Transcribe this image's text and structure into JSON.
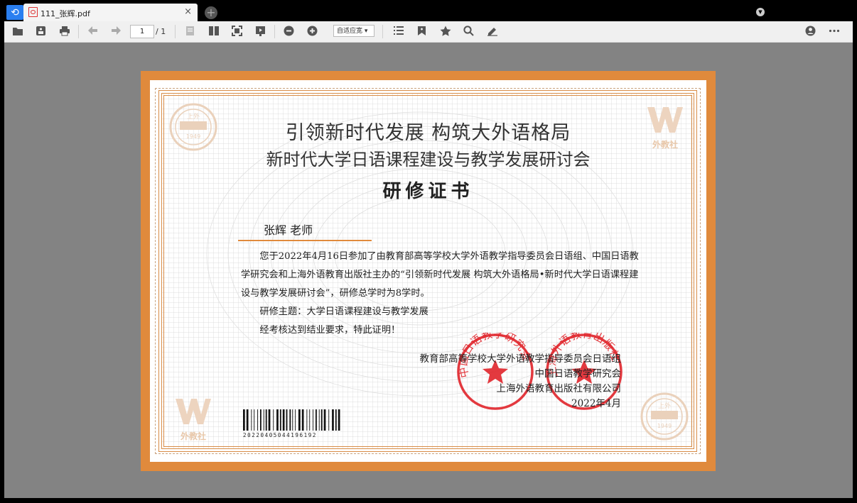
{
  "tab": {
    "title": "111_张辉.pdf",
    "close": "×",
    "new_tab": "+"
  },
  "toolbar": {
    "page_current": "1",
    "page_total": "/ 1",
    "zoom": "自适应宽 ▾"
  },
  "icons": [
    "open-folder-icon",
    "save-icon",
    "print-icon",
    "prev-page-icon",
    "next-page-icon",
    "single-page-icon",
    "two-page-icon",
    "fit-page-icon",
    "present-icon",
    "zoom-out-icon",
    "zoom-in-icon",
    "list-icon",
    "bookmark-icon",
    "star-icon",
    "search-icon",
    "pen-icon",
    "account-icon",
    "more-icon"
  ],
  "certificate": {
    "title1": "引领新时代发展 构筑大外语格局",
    "title2": "新时代大学日语课程建设与教学发展研讨会",
    "title3": "研修证书",
    "recipient": "张辉  老师",
    "para1": "您于2022年4月16日参加了由教育部高等学校大学外语教学指导委员会日语组、中国日语教学研究会和上海外语教育出版社主办的“引领新时代发展 构筑大外语格局•新时代大学日语课程建设与教学发展研讨会”，研修总学时为8学时。",
    "para2": "研修主题：大学日语课程建设与教学发展",
    "para3": "经考核达到结业要求，特此证明！",
    "issuer1": "教育部高等学校大学外语教学指导委员会日语组",
    "issuer2": "中国日语教学研究会",
    "issuer3": "上海外语教育出版社有限公司",
    "date": "2022年4月",
    "barcode": "20220405044196192",
    "logo_text": "外教社",
    "emblem_year": "1949",
    "emblem_top": "上外",
    "seal1": "中国日语教学研究会",
    "seal2": "上海外语教育出版社"
  },
  "colors": {
    "frame": "#e08a3c",
    "seal": "#e0242a",
    "accent": "#2a7ff0"
  }
}
